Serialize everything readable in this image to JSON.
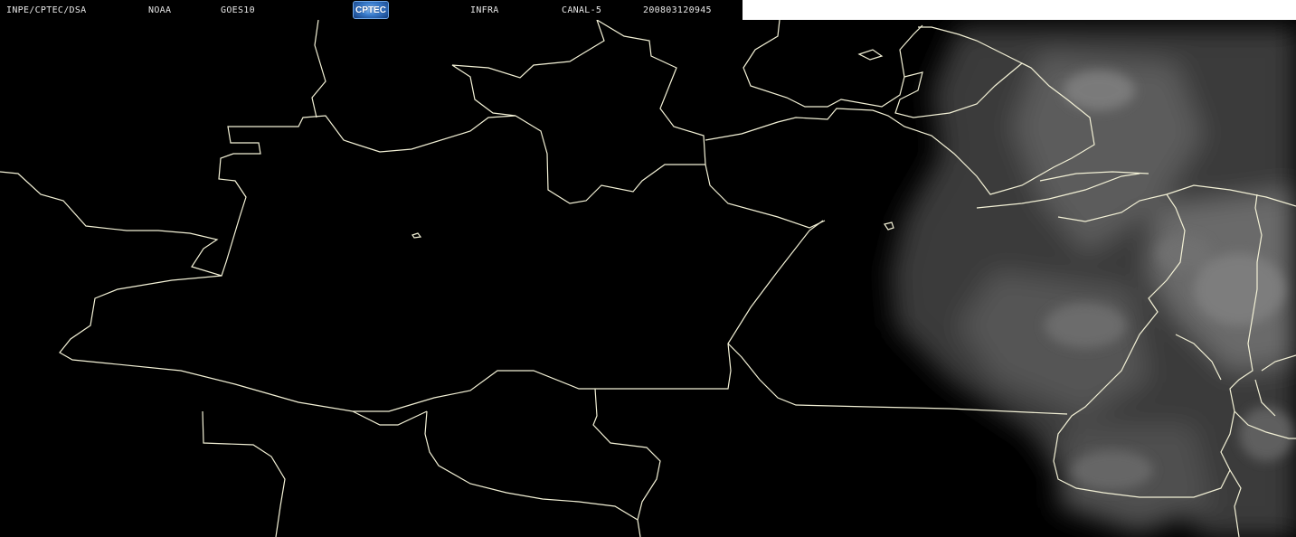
{
  "header": {
    "agency": "INPE/CPTEC/DSA",
    "provider": "NOAA",
    "satellite": "GOES10",
    "logo_text": "CPTEC",
    "product": "INFRA",
    "channel": "CANAL-5",
    "timestamp": "200803120945"
  },
  "colors": {
    "background": "#000000",
    "borders": "#f3f1d6",
    "clouds": "#8c8c8c",
    "header_text": "#e6e6e6"
  }
}
